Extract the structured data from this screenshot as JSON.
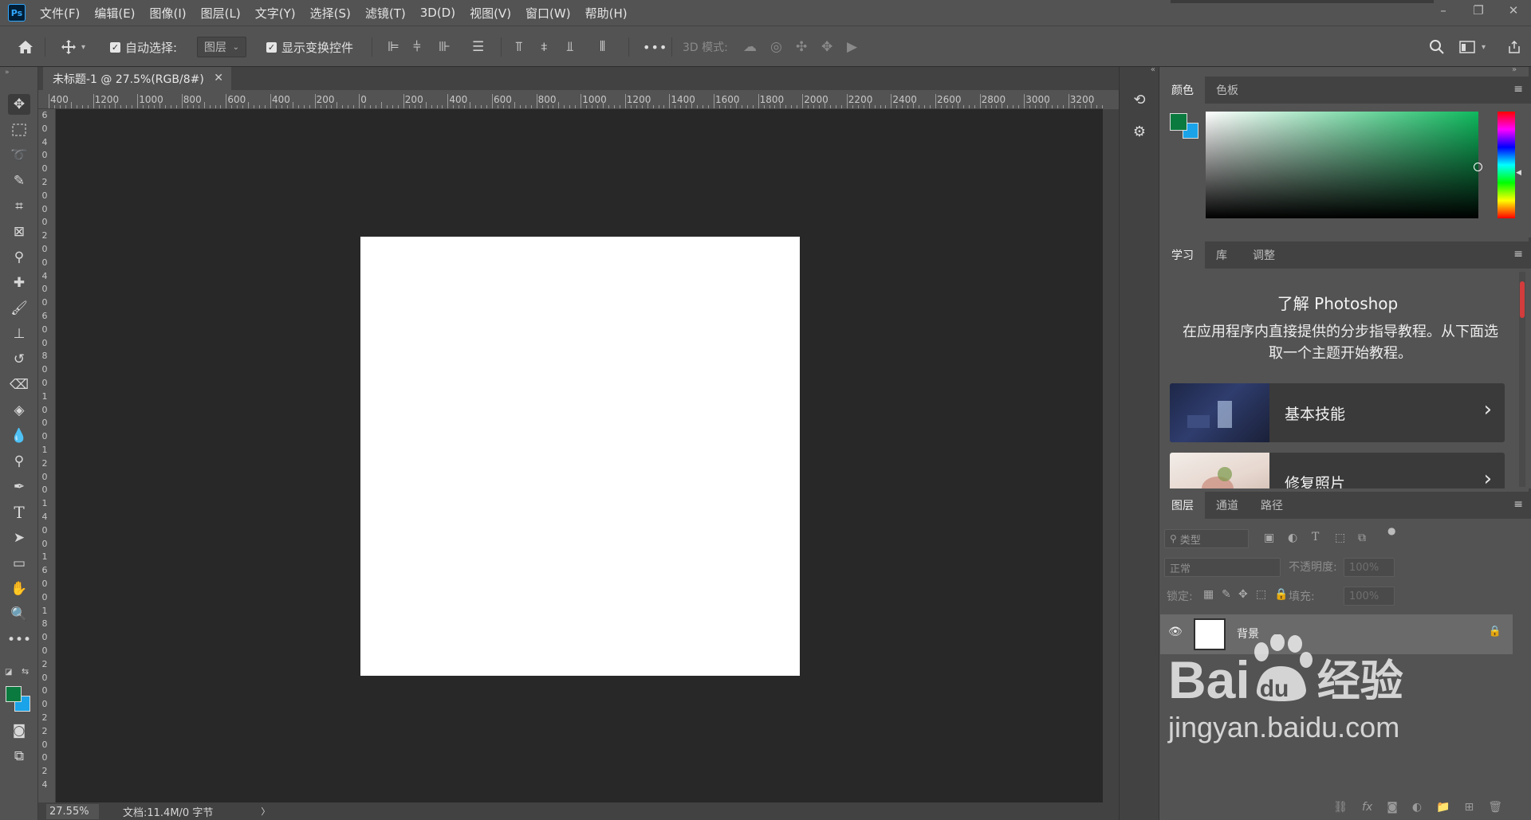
{
  "menubar": {
    "app_logo": "Ps",
    "items": [
      "文件(F)",
      "编辑(E)",
      "图像(I)",
      "图层(L)",
      "文字(Y)",
      "选择(S)",
      "滤镜(T)",
      "3D(D)",
      "视图(V)",
      "窗口(W)",
      "帮助(H)"
    ],
    "window_controls": {
      "minimize": "–",
      "restore": "❐",
      "close": "✕"
    }
  },
  "options": {
    "auto_select_label": "自动选择:",
    "auto_select_target": "图层",
    "auto_select_checked": true,
    "show_transform_label": "显示变换控件",
    "show_transform_checked": true,
    "mode_3d_label": "3D 模式:",
    "more": "•••"
  },
  "document": {
    "tab_title": "未标题-1 @ 27.5%(RGB/8#)",
    "tab_close": "✕",
    "zoom": "27.55%",
    "doc_info": "文档:11.4M/0 字节",
    "status_arrow": "〉",
    "ruler_top": [
      "400",
      "1200",
      "1000",
      "800",
      "600",
      "400",
      "200",
      "0",
      "200",
      "400",
      "600",
      "800",
      "1000",
      "1200",
      "1400",
      "1600",
      "1800",
      "2000",
      "2200",
      "2400",
      "2600",
      "2800",
      "3000",
      "3200"
    ],
    "ruler_left": [
      "6",
      "0",
      "4",
      "0",
      "0",
      "2",
      "0",
      "0",
      "0",
      "2",
      "0",
      "0",
      "4",
      "0",
      "0",
      "6",
      "0",
      "0",
      "8",
      "0",
      "0",
      "1",
      "0",
      "0",
      "0",
      "1",
      "2",
      "0",
      "0",
      "1",
      "4",
      "0",
      "0",
      "1",
      "6",
      "0",
      "0",
      "1",
      "8",
      "0",
      "0",
      "2",
      "0",
      "0",
      "0",
      "2",
      "2",
      "0",
      "0",
      "2",
      "4"
    ]
  },
  "color_panel": {
    "tabs": [
      "颜色",
      "色板"
    ],
    "active_tab": "颜色",
    "foreground": "#0a7a3e",
    "background": "#1aa3e8"
  },
  "learn_panel": {
    "tabs": [
      "学习",
      "库",
      "调整"
    ],
    "active_tab": "学习",
    "title": "了解 Photoshop",
    "description": "在应用程序内直接提供的分步指导教程。从下面选取一个主题开始教程。",
    "cards": [
      {
        "title": "基本技能"
      },
      {
        "title": "修复照片"
      }
    ]
  },
  "layers_panel": {
    "tabs": [
      "图层",
      "通道",
      "路径"
    ],
    "active_tab": "图层",
    "filter_placeholder": "类型",
    "blend_mode": "正常",
    "opacity_label": "不透明度:",
    "opacity_value": "100%",
    "lock_label": "锁定:",
    "fill_label": "填充:",
    "fill_value": "100%",
    "layers": [
      {
        "name": "背景",
        "visible": true,
        "locked": true
      }
    ]
  },
  "watermark": {
    "brand": "Bai",
    "brand_du": "du",
    "brand_suffix": "经验",
    "url": "jingyan.baidu.com"
  }
}
